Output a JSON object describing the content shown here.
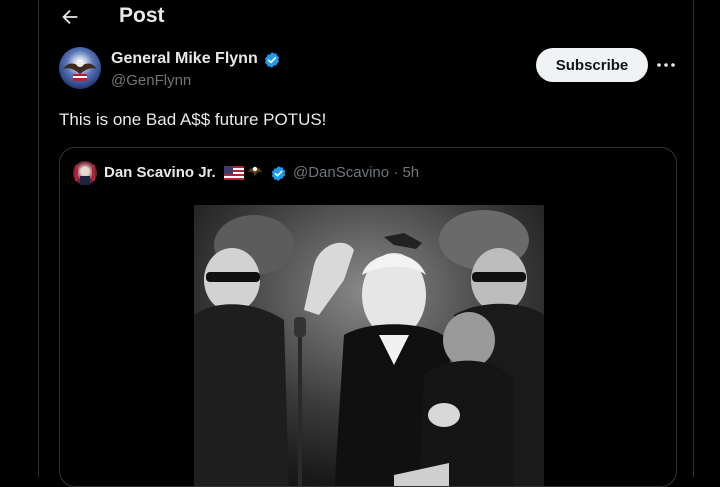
{
  "header": {
    "title": "Post",
    "back_icon": "arrow-left-icon"
  },
  "post": {
    "author_name": "General Mike Flynn",
    "author_handle": "@GenFlynn",
    "subscribe_label": "Subscribe",
    "more_icon": "more-horizontal-icon",
    "text": "This is one Bad A$$ future POTUS!"
  },
  "quote": {
    "author_name": "Dan Scavino Jr.",
    "handle_time": "@DanScavino · 5h",
    "emoji": [
      "us-flag-icon",
      "eagle-icon"
    ],
    "media_description": "black-and-white photo"
  },
  "colors": {
    "background": "#000000",
    "text": "#e7e9ea",
    "muted": "#71767b",
    "verified": "#1d9bf0",
    "border": "#2f3336"
  }
}
